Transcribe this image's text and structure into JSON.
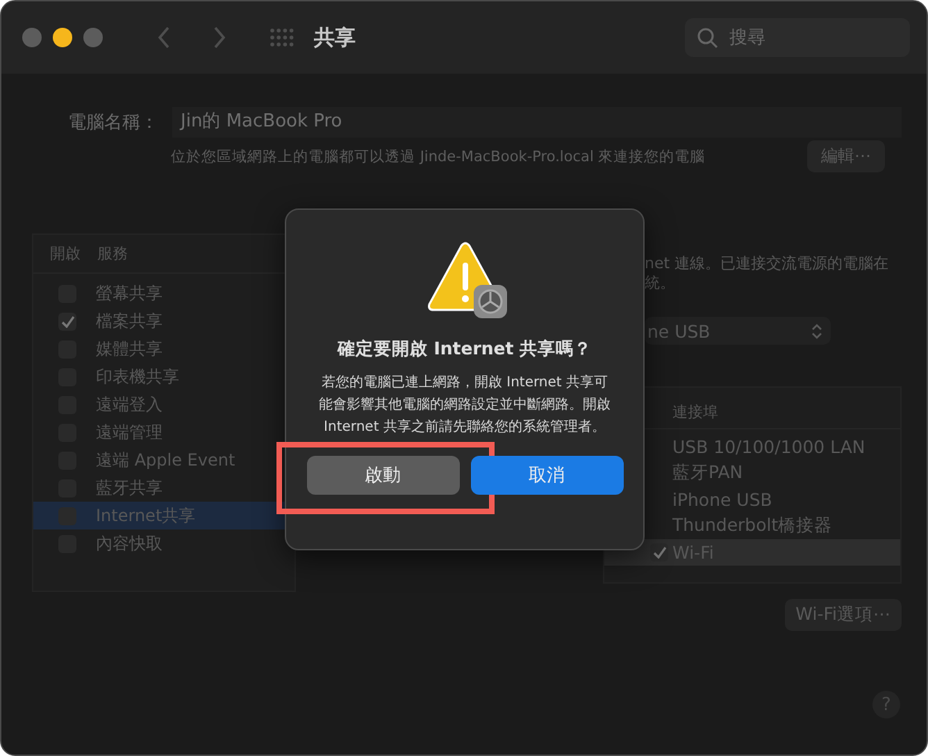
{
  "window": {
    "title": "共享",
    "search": {
      "placeholder": "搜尋"
    }
  },
  "computer_name": {
    "label": "電腦名稱：",
    "value": "Jin的 MacBook Pro",
    "hint": "位於您區域網路上的電腦都可以透過 Jinde-MacBook-Pro.local 來連接您的電腦",
    "edit_button": "編輯⋯"
  },
  "services": {
    "columns": [
      "開啟",
      "服務"
    ],
    "rows": [
      {
        "name": "螢幕共享",
        "checked": false,
        "selected": false
      },
      {
        "name": "檔案共享",
        "checked": true,
        "selected": false
      },
      {
        "name": "媒體共享",
        "checked": false,
        "selected": false
      },
      {
        "name": "印表機共享",
        "checked": false,
        "selected": false
      },
      {
        "name": "遠端登入",
        "checked": false,
        "selected": false
      },
      {
        "name": "遠端管理",
        "checked": false,
        "selected": false
      },
      {
        "name": "遠端 Apple Event",
        "checked": false,
        "selected": false
      },
      {
        "name": "藍牙共享",
        "checked": false,
        "selected": false
      },
      {
        "name": "Internet共享",
        "checked": false,
        "selected": true
      },
      {
        "name": "內容快取",
        "checked": false,
        "selected": false
      }
    ]
  },
  "detail": {
    "description": [
      "net 連線。已連接交流電源的電腦在",
      "統。"
    ],
    "source_popup": "ne USB",
    "ports_header": "連接埠",
    "ports": [
      {
        "name": "USB 10/100/1000 LAN",
        "selected": false
      },
      {
        "name": "藍牙PAN",
        "selected": false
      },
      {
        "name": "iPhone USB",
        "selected": false
      },
      {
        "name": "Thunderbolt橋接器",
        "selected": false
      },
      {
        "name": "Wi-Fi",
        "selected": true,
        "checked": true
      }
    ],
    "options_button": "Wi-Fi選項⋯"
  },
  "help_button": "?",
  "dialog": {
    "title": "確定要開啟 Internet 共享嗎？",
    "message": "若您的電腦已連上網路，開啟 Internet 共享可能會影響其他電腦的網路設定並中斷網路。開啟 Internet 共享之前請先聯絡您的系統管理者。",
    "buttons": [
      {
        "label": "啟動",
        "kind": "secondary",
        "highlighted": true
      },
      {
        "label": "取消",
        "kind": "primary",
        "highlighted": false
      }
    ]
  }
}
